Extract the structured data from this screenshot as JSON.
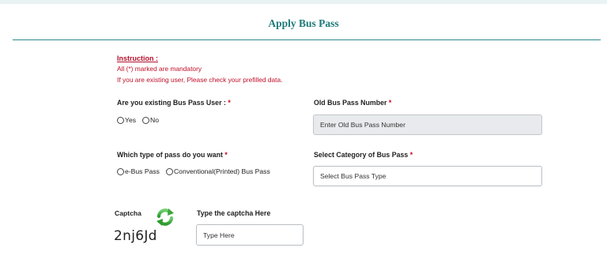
{
  "header": {
    "title": "Apply Bus Pass"
  },
  "instructions": {
    "title": "Instruction :",
    "line1": "All (*) marked are mandatory",
    "line2": "If you are existing user, Please check your prefilled data."
  },
  "existing_user": {
    "label": "Are you existing Bus Pass User :",
    "required_mark": "*",
    "options": [
      "Yes",
      "No"
    ]
  },
  "old_pass_number": {
    "label": "Old Bus Pass Number",
    "required_mark": "*",
    "placeholder": "Enter Old Bus Pass Number"
  },
  "pass_type": {
    "label": "Which type of pass do you want",
    "required_mark": "*",
    "options": [
      "e-Bus Pass",
      "Conventional(Printed) Bus Pass"
    ]
  },
  "pass_category": {
    "label": "Select Category of Bus Pass",
    "required_mark": "*",
    "selected": "Select Bus Pass Type"
  },
  "captcha": {
    "label": "Captcha",
    "code": "2nj6Jd",
    "input_label": "Type the captcha Here",
    "input_placeholder": "Type Here",
    "refresh_icon": "refresh-icon"
  },
  "colors": {
    "accent": "#1f7a7a",
    "instruction_red": "#c0102a",
    "refresh_green": "#3aa53a"
  }
}
